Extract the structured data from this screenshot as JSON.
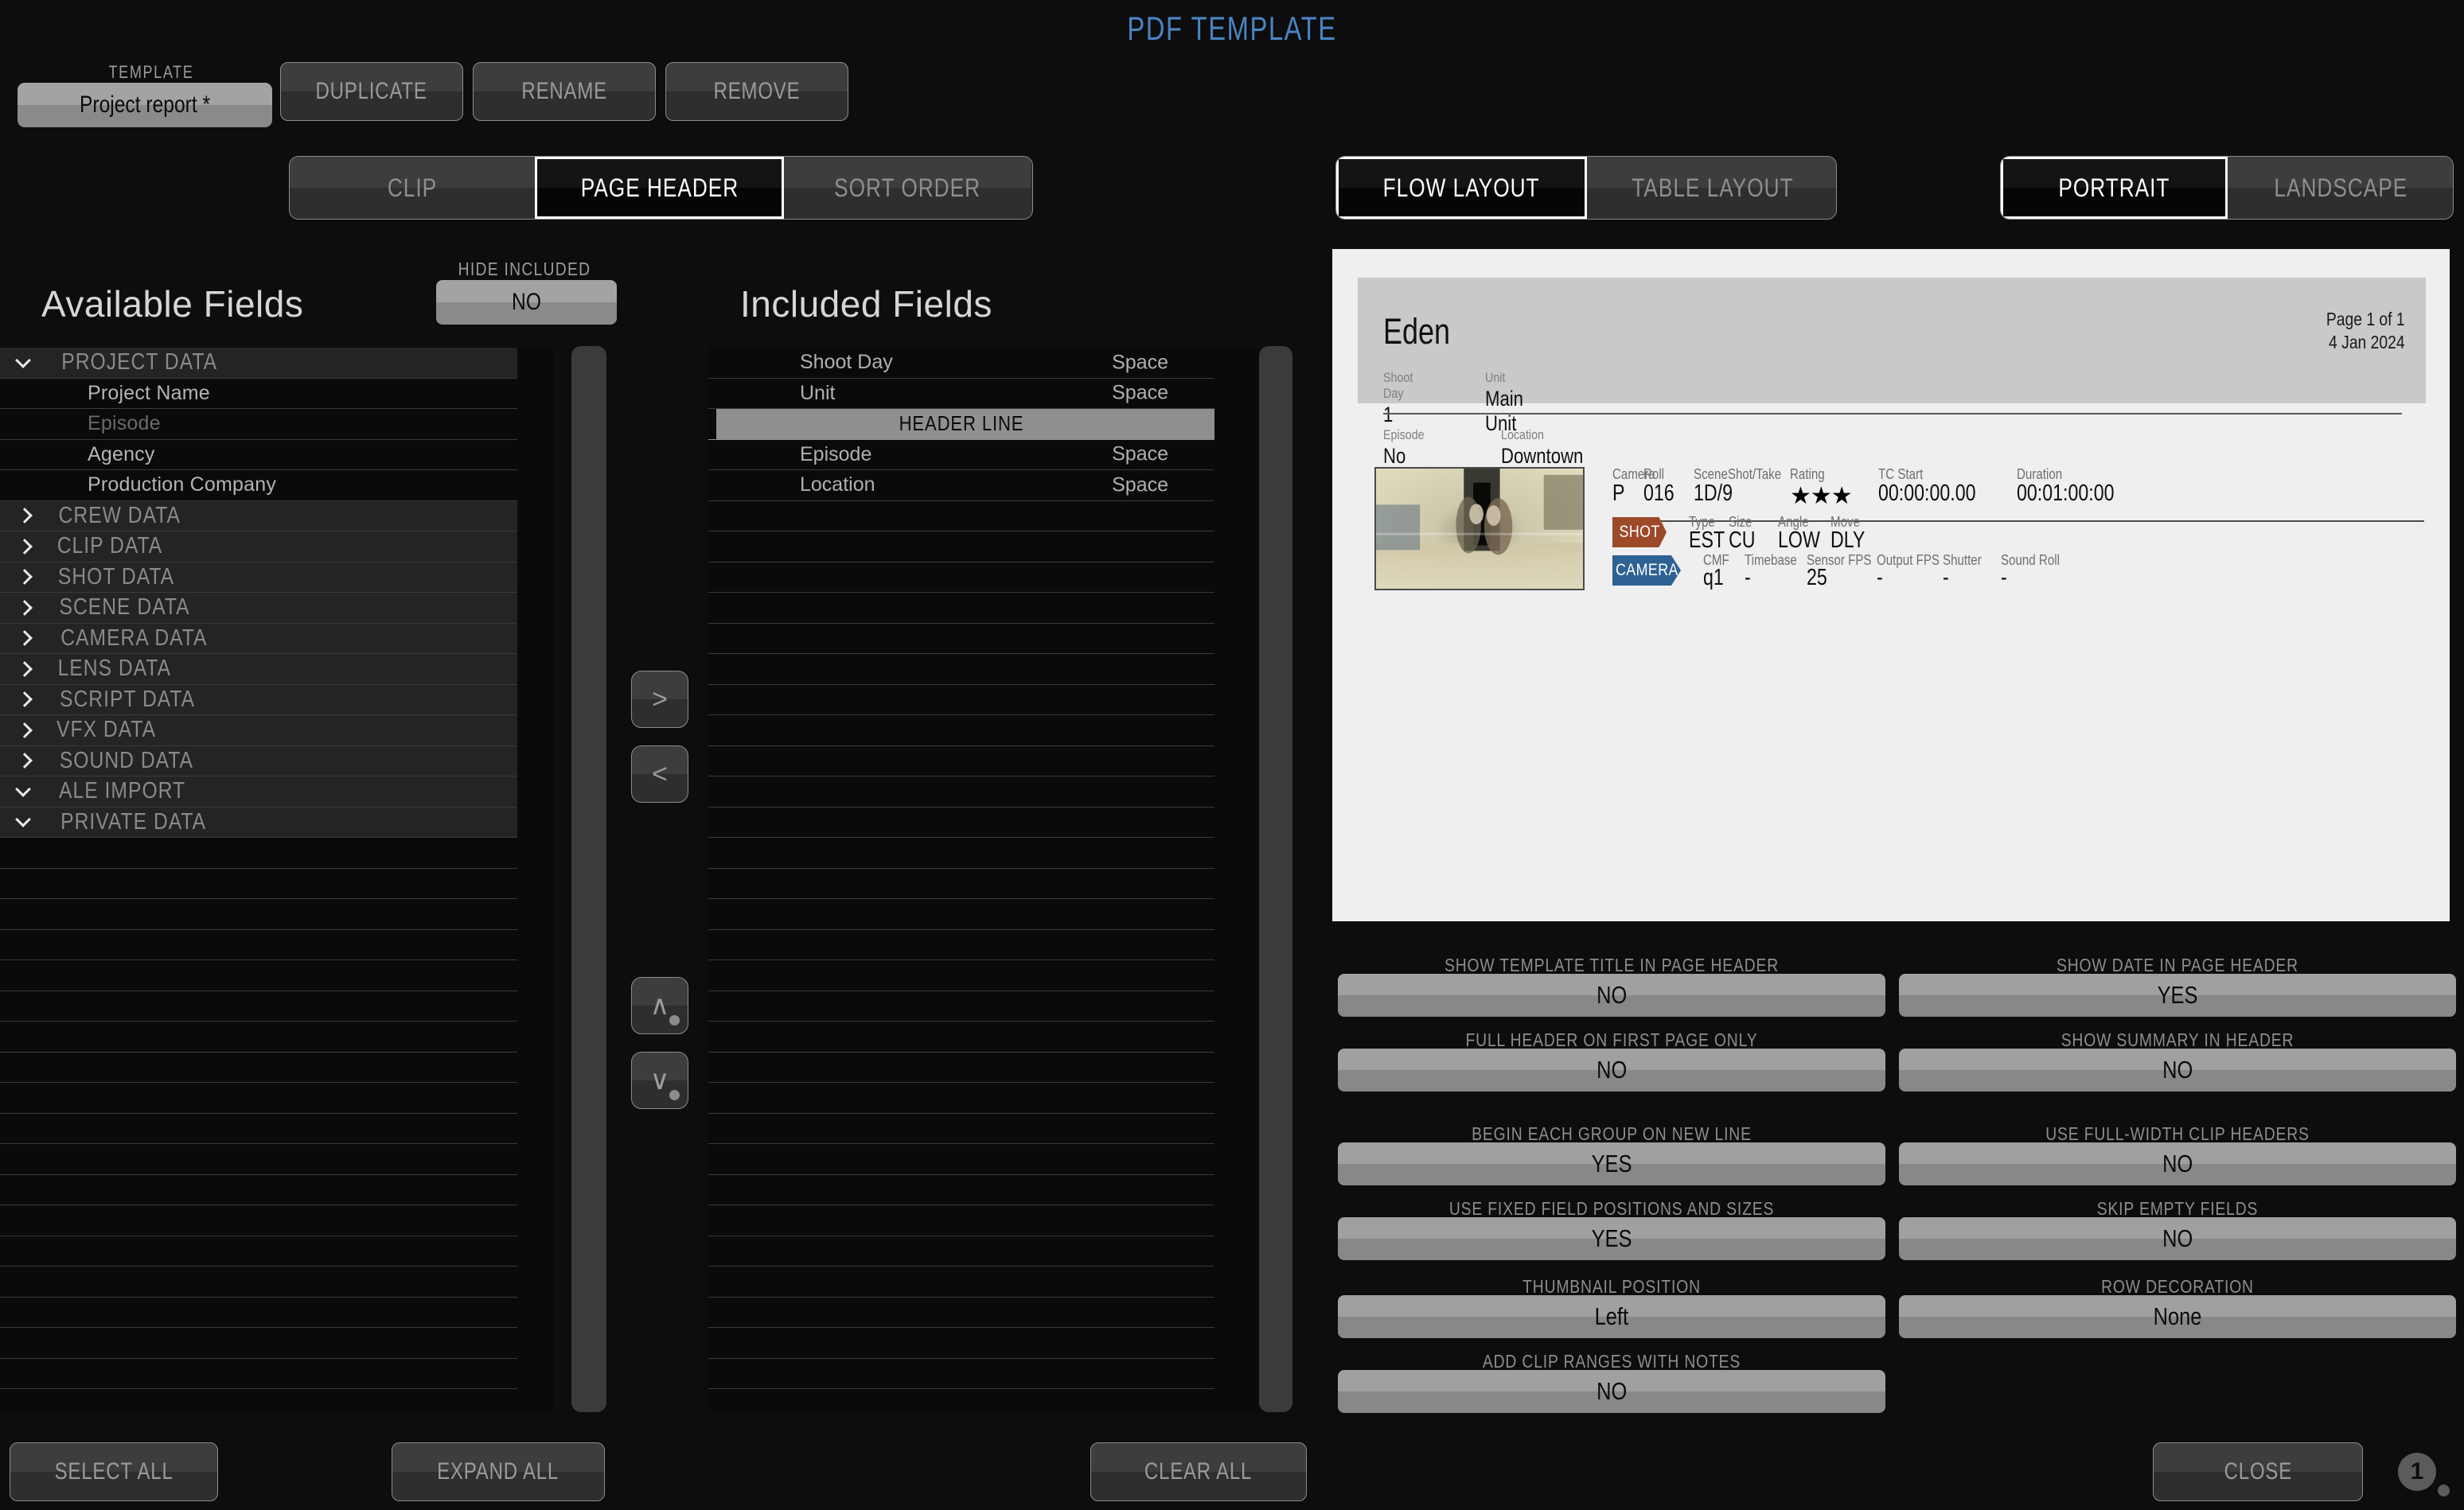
{
  "window": {
    "title": "PDF TEMPLATE"
  },
  "template": {
    "label": "TEMPLATE",
    "value": "Project report *",
    "duplicate": "DUPLICATE",
    "rename": "RENAME",
    "remove": "REMOVE"
  },
  "tabs_main": [
    {
      "label": "CLIP",
      "active": false
    },
    {
      "label": "PAGE HEADER",
      "active": true
    },
    {
      "label": "SORT ORDER",
      "active": false
    }
  ],
  "tabs_layout": [
    {
      "label": "FLOW LAYOUT",
      "active": true
    },
    {
      "label": "TABLE LAYOUT",
      "active": false
    }
  ],
  "tabs_orientation": [
    {
      "label": "PORTRAIT",
      "active": true
    },
    {
      "label": "LANDSCAPE",
      "active": false
    }
  ],
  "available": {
    "title": "Available Fields",
    "hide_included_label": "HIDE INCLUDED",
    "hide_included_value": "NO",
    "groups": [
      {
        "label": "PROJECT DATA",
        "expanded": true,
        "fields": [
          {
            "label": "Project Name",
            "dim": false
          },
          {
            "label": "Episode",
            "dim": true
          },
          {
            "label": "Agency",
            "dim": false
          },
          {
            "label": "Production Company",
            "dim": false
          }
        ]
      },
      {
        "label": "CREW DATA",
        "expanded": false,
        "fields": []
      },
      {
        "label": "CLIP DATA",
        "expanded": false,
        "fields": []
      },
      {
        "label": "SHOT DATA",
        "expanded": false,
        "fields": []
      },
      {
        "label": "SCENE DATA",
        "expanded": false,
        "fields": []
      },
      {
        "label": "CAMERA DATA",
        "expanded": false,
        "fields": []
      },
      {
        "label": "LENS DATA",
        "expanded": false,
        "fields": []
      },
      {
        "label": "SCRIPT DATA",
        "expanded": false,
        "fields": []
      },
      {
        "label": "VFX DATA",
        "expanded": false,
        "fields": []
      },
      {
        "label": "SOUND DATA",
        "expanded": false,
        "fields": []
      },
      {
        "label": "ALE IMPORT",
        "expanded": true,
        "fields": []
      },
      {
        "label": "PRIVATE DATA",
        "expanded": true,
        "fields": []
      }
    ]
  },
  "included": {
    "title": "Included Fields",
    "rows": [
      {
        "label": "Shoot Day",
        "value": "Space",
        "selected": false
      },
      {
        "label": "Unit",
        "value": "Space",
        "selected": false
      },
      {
        "label": "HEADER LINE",
        "value": "",
        "selected": true
      },
      {
        "label": "Episode",
        "value": "Space",
        "selected": false
      },
      {
        "label": "Location",
        "value": "Space",
        "selected": false
      }
    ]
  },
  "transfer": {
    "move_right": ">",
    "move_left": "<",
    "move_up": "∧",
    "move_down": "∨"
  },
  "preview": {
    "doc_title": "Eden",
    "page_of": "Page 1 of 1",
    "date": "4 Jan 2024",
    "header_fields": [
      {
        "label": "Shoot Day",
        "value": "1"
      },
      {
        "label": "Unit",
        "value": "Main Unit"
      },
      {
        "label": "Episode",
        "value": "No Episode"
      },
      {
        "label": "Location",
        "value": "Downtown"
      }
    ],
    "clip": {
      "top_row": [
        {
          "label": "Camera",
          "value": "P"
        },
        {
          "label": "Roll",
          "value": "016"
        },
        {
          "label": "SceneShot/Take",
          "value": "1D/9"
        },
        {
          "label": "Rating",
          "value": "★★★"
        },
        {
          "label": "TC Start",
          "value": "00:00:00.00"
        },
        {
          "label": "Duration",
          "value": "00:01:00:00"
        }
      ],
      "shot_tag": "SHOT",
      "shot_row": [
        {
          "label": "Type",
          "value": "EST"
        },
        {
          "label": "Size",
          "value": "CU"
        },
        {
          "label": "Angle",
          "value": "LOW"
        },
        {
          "label": "Move",
          "value": "DLY"
        }
      ],
      "camera_tag": "CAMERA",
      "camera_row": [
        {
          "label": "CMF",
          "value": "q1"
        },
        {
          "label": "Timebase",
          "value": "-"
        },
        {
          "label": "Sensor FPS",
          "value": "25"
        },
        {
          "label": "Output FPS",
          "value": "-"
        },
        {
          "label": "Shutter",
          "value": "-"
        },
        {
          "label": "Sound Roll",
          "value": "-"
        }
      ]
    }
  },
  "settings": [
    {
      "label": "SHOW TEMPLATE TITLE IN PAGE HEADER",
      "value": "NO",
      "col": "L",
      "row": 0
    },
    {
      "label": "SHOW DATE IN PAGE HEADER",
      "value": "YES",
      "col": "R",
      "row": 0
    },
    {
      "label": "FULL HEADER ON FIRST PAGE ONLY",
      "value": "NO",
      "col": "L",
      "row": 1
    },
    {
      "label": "SHOW SUMMARY IN HEADER",
      "value": "NO",
      "col": "R",
      "row": 1
    },
    {
      "label": "BEGIN EACH GROUP ON NEW LINE",
      "value": "YES",
      "col": "L",
      "row": 2
    },
    {
      "label": "USE FULL-WIDTH CLIP HEADERS",
      "value": "NO",
      "col": "R",
      "row": 2
    },
    {
      "label": "USE FIXED FIELD POSITIONS AND SIZES",
      "value": "YES",
      "col": "L",
      "row": 3
    },
    {
      "label": "SKIP EMPTY FIELDS",
      "value": "NO",
      "col": "R",
      "row": 3
    },
    {
      "label": "THUMBNAIL POSITION",
      "value": "Left",
      "col": "L",
      "row": 4
    },
    {
      "label": "ROW DECORATION",
      "value": "None",
      "col": "R",
      "row": 4
    },
    {
      "label": "ADD CLIP RANGES WITH NOTES",
      "value": "NO",
      "col": "L",
      "row": 5
    }
  ],
  "footer": {
    "select_all": "SELECT ALL",
    "expand_all": "EXPAND ALL",
    "clear_all": "CLEAR ALL",
    "close": "CLOSE",
    "page_badge": "1"
  },
  "colors": {
    "accent": "#4a84c4",
    "background": "#0d0d0d",
    "shot_tag": "#9c4a2a",
    "camera_tag": "#2e6294"
  }
}
